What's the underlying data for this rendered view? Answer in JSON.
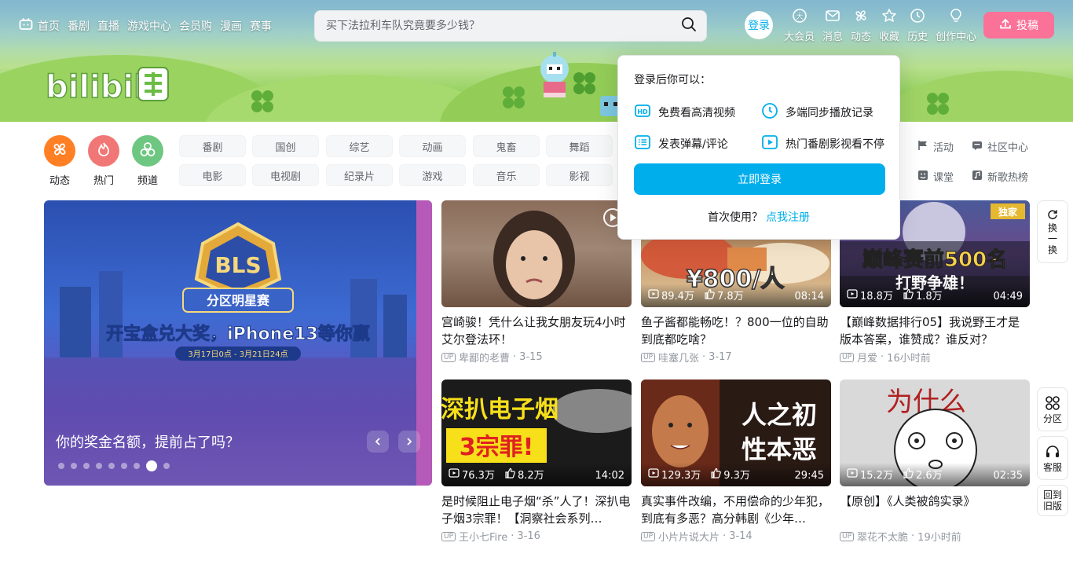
{
  "left_nav": {
    "items": [
      "首页",
      "番剧",
      "直播",
      "游戏中心",
      "会员购",
      "漫画",
      "赛事"
    ]
  },
  "search": {
    "placeholder": "买下法拉利车队究竟要多少钱？"
  },
  "header": {
    "login_label": "登录",
    "entries": [
      "大会员",
      "消息",
      "动态",
      "收藏",
      "历史",
      "创作中心"
    ],
    "upload_label": "投稿"
  },
  "banner": {
    "logo_text": "bilibili"
  },
  "channels": {
    "icons": [
      {
        "label": "动态",
        "color": "#ff7f24"
      },
      {
        "label": "热门",
        "color": "#f07775"
      },
      {
        "label": "频道",
        "color": "#6dc781"
      }
    ],
    "row1": [
      "番剧",
      "国创",
      "综艺",
      "动画",
      "鬼畜",
      "舞蹈"
    ],
    "row2": [
      "电影",
      "电视剧",
      "纪录片",
      "游戏",
      "音乐",
      "影视"
    ],
    "right_links": [
      "活动",
      "社区中心",
      "课堂",
      "新歌热榜"
    ]
  },
  "carousel": {
    "caption": "你的奖金名额，提前占了吗？",
    "slide_text": "开宝盒兑大奖，iPhone13等你赢",
    "badge_text": "BLS",
    "badge_sub": "分区明星赛",
    "dates": "3月17日0点 - 3月21日24点",
    "active_dot": 7,
    "dot_count": 9
  },
  "videos": [
    {
      "title": "宫崎骏！凭什么让我女朋友玩4小时艾尔登法环！",
      "author": "卑鄙的老曹",
      "date": "3-15"
    },
    {
      "title": "鱼子酱都能畅吃！？800一位的自助到底都吃啥？",
      "author": "哇塞几张",
      "date": "3-17",
      "plays": "89.4万",
      "likes": "7.8万",
      "duration": "08:14",
      "overlay": "¥800/人"
    },
    {
      "title": "【巅峰数据排行05】我说野王才是版本答案，谁赞成？谁反对？",
      "author": "月爱",
      "date": "16小时前",
      "plays": "18.8万",
      "likes": "1.8万",
      "duration": "04:49",
      "overlay_top": "巅峰赛前500名",
      "overlay_bottom": "打野争雄！",
      "tag": "独家"
    },
    {
      "title": "是时候阻止电子烟“杀”人了！深扒电子烟3宗罪！【洞察社会系列…",
      "author": "王小七Fire",
      "date": "3-16",
      "plays": "76.3万",
      "likes": "8.2万",
      "duration": "14:02",
      "overlay_top": "深扒电子烟",
      "overlay_bottom": "3宗罪!"
    },
    {
      "title": "真实事件改编，不用偿命的少年犯，到底有多恶？高分韩剧《少年…",
      "author": "小片片说大片",
      "date": "3-14",
      "plays": "129.3万",
      "likes": "9.3万",
      "duration": "29:45",
      "overlay_top": "人之初",
      "overlay_bottom": "性本恶"
    },
    {
      "title": "【原创】《人类被鸽实录》",
      "author": "翠花不太脆",
      "date": "19小时前",
      "plays": "15.2万",
      "likes": "2.6万",
      "duration": "02:35",
      "overlay_top": "为什么"
    }
  ],
  "side_buttons": {
    "refresh": "换一换",
    "zone": "分区",
    "service": "客服",
    "old": "回到旧版"
  },
  "popup": {
    "title": "登录后你可以：",
    "benefits": [
      "免费看高清视频",
      "多端同步播放记录",
      "发表弹幕/评论",
      "热门番剧影视看不停"
    ],
    "login_button": "立即登录",
    "first_use": "首次使用？",
    "register_link": "点我注册"
  },
  "colors": {
    "accent": "#00aeec",
    "upload": "#fb7299"
  }
}
